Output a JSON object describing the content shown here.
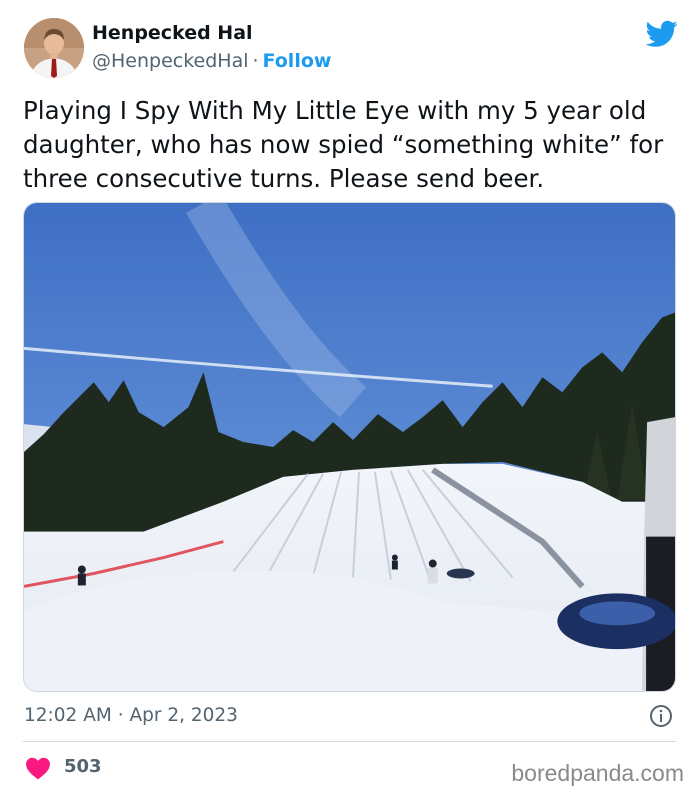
{
  "author": {
    "name": "Henpecked Hal",
    "handle": "@HenpeckedHal",
    "separator": "·",
    "follow_label": "Follow",
    "avatar_icon": "profile-photo",
    "platform_icon": "twitter-bird-icon"
  },
  "tweet": {
    "text": "Playing I Spy With My Little Eye with my 5 year old daughter, who has now spied “something white” for three consecutive turns. Please send beer.",
    "timestamp": "12:02 AM · Apr 2, 2023",
    "likes": "503"
  },
  "watermark": "boredpanda.com",
  "colors": {
    "accent": "#1d9bf0",
    "like": "#f91880",
    "meta": "#536471"
  }
}
